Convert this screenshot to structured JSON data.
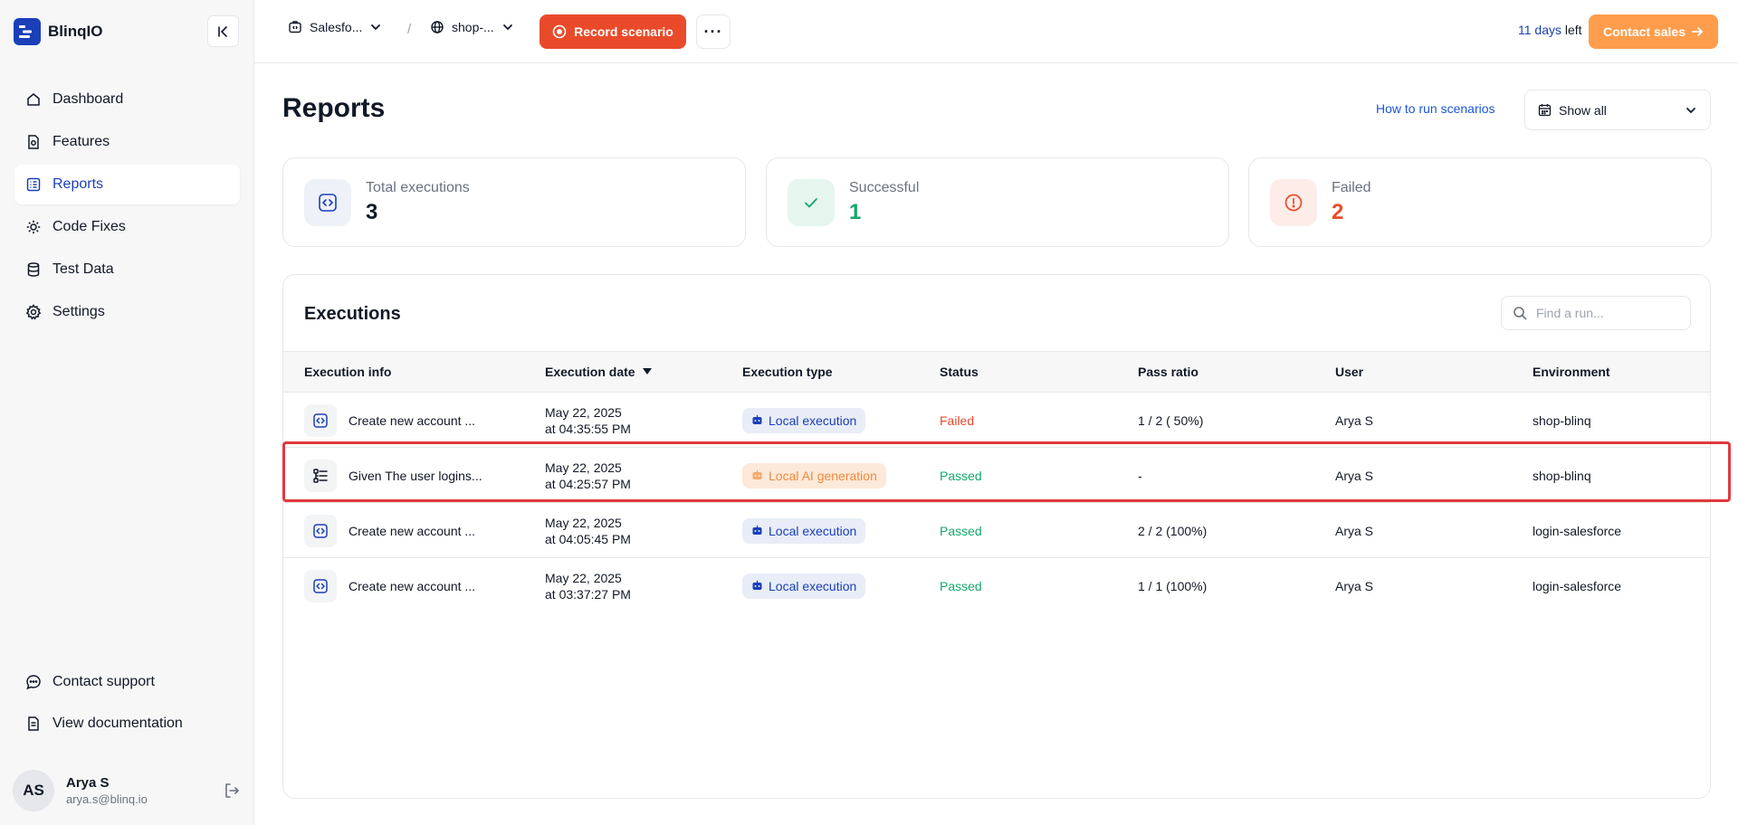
{
  "brand": {
    "name": "BlinqIO"
  },
  "sidebar": {
    "items": [
      {
        "label": "Dashboard",
        "icon": "home-icon"
      },
      {
        "label": "Features",
        "icon": "features-icon"
      },
      {
        "label": "Reports",
        "icon": "list-icon",
        "active": true
      },
      {
        "label": "Code Fixes",
        "icon": "code-fix-icon"
      },
      {
        "label": "Test Data",
        "icon": "database-icon"
      },
      {
        "label": "Settings",
        "icon": "gear-icon"
      }
    ],
    "bottom": [
      {
        "label": "Contact support",
        "icon": "chat-icon"
      },
      {
        "label": "View documentation",
        "icon": "document-icon"
      }
    ],
    "user": {
      "initials": "AS",
      "name": "Arya S",
      "email": "arya.s@blinq.io"
    }
  },
  "topbar": {
    "project": "Salesfo...",
    "separator": "/",
    "environment": "shop-...",
    "record_label": "Record scenario",
    "more_label": "···",
    "trial_days": "11 days",
    "trial_suffix": " left",
    "contact_sales": "Contact sales"
  },
  "page": {
    "title": "Reports",
    "howto_link": "How to run scenarios",
    "filter_value": "Show all"
  },
  "stats": {
    "total": {
      "label": "Total executions",
      "value": "3"
    },
    "successful": {
      "label": "Successful",
      "value": "1"
    },
    "failed": {
      "label": "Failed",
      "value": "2"
    }
  },
  "executions": {
    "title": "Executions",
    "search_placeholder": "Find a run...",
    "columns": [
      "Execution info",
      "Execution date",
      "Execution type",
      "Status",
      "Pass ratio",
      "User",
      "Environment"
    ],
    "rows": [
      {
        "info": "Create new account ...",
        "date1": "May 22, 2025",
        "date2": "at 04:35:55 PM",
        "type": "Local execution",
        "status": "Failed",
        "ratio": "1 / 2 ( 50%)",
        "user": "Arya S",
        "env": "shop-blinq"
      },
      {
        "info": "Given The user logins...",
        "date1": "May 22, 2025",
        "date2": "at 04:25:57 PM",
        "type": "Local AI generation",
        "status": "Passed",
        "ratio": "-",
        "user": "Arya S",
        "env": "shop-blinq"
      },
      {
        "info": "Create new account ...",
        "date1": "May 22, 2025",
        "date2": "at 04:05:45 PM",
        "type": "Local execution",
        "status": "Passed",
        "ratio": "2 / 2 (100%)",
        "user": "Arya S",
        "env": "login-salesforce"
      },
      {
        "info": "Create new account ...",
        "date1": "May 22, 2025",
        "date2": "at 03:37:27 PM",
        "type": "Local execution",
        "status": "Passed",
        "ratio": "1 / 1 (100%)",
        "user": "Arya S",
        "env": "login-salesforce"
      }
    ]
  },
  "colors": {
    "brand": "#1a3fb8",
    "record": "#e94b2a",
    "contact_sales": "#ff9d4c",
    "passed": "#14a86b",
    "failed": "#e94b2a",
    "highlight": "#e0393e"
  }
}
